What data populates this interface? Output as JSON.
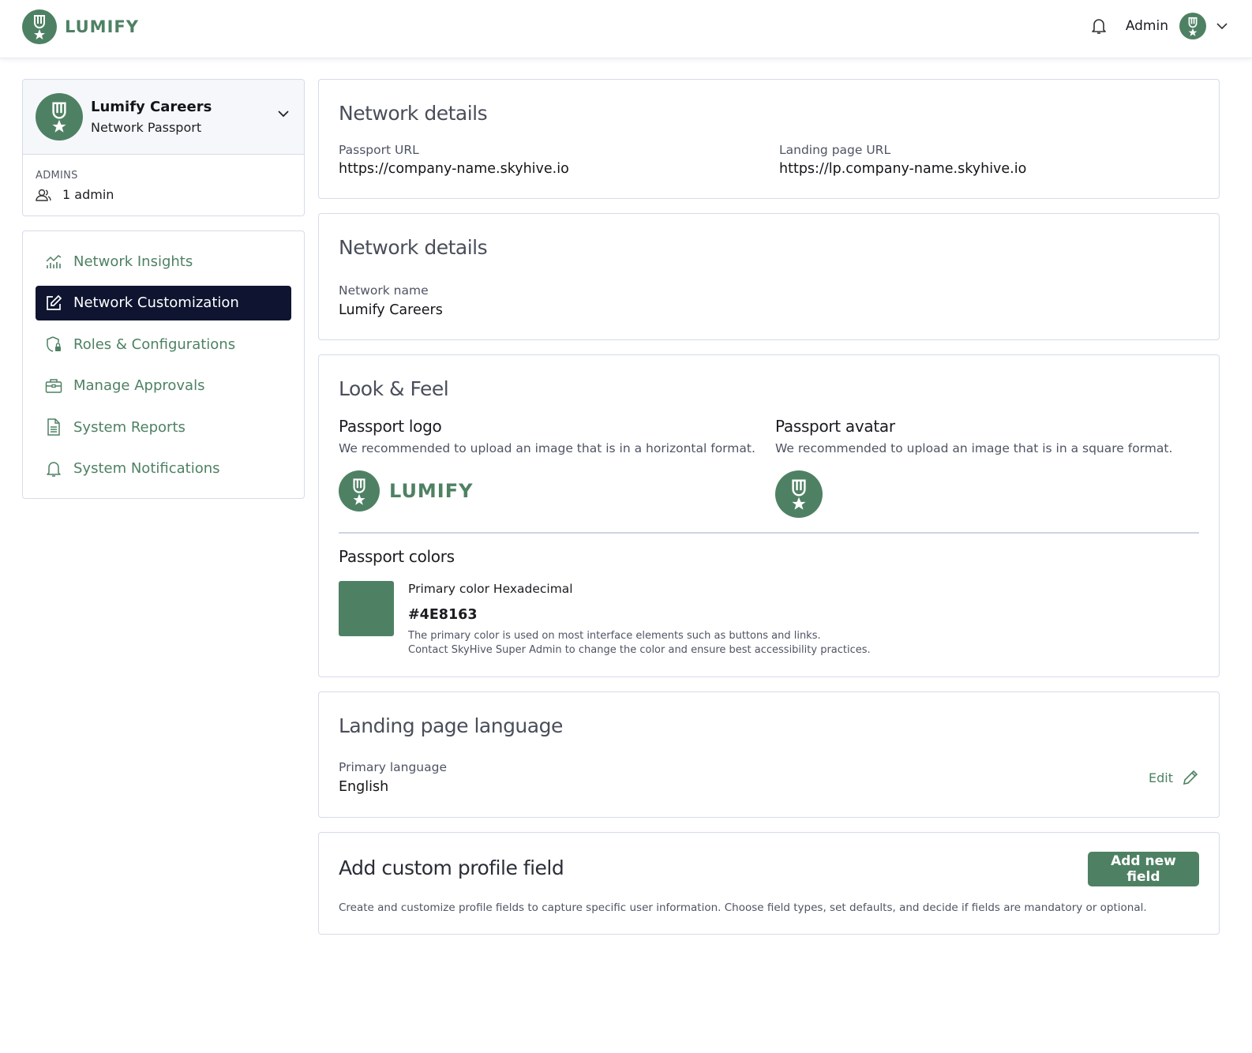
{
  "app": {
    "brand": "LUMIFY",
    "accent_color": "#4E8163",
    "nav_dark": "#0f1530"
  },
  "header": {
    "notification_icon": "bell-icon",
    "user_name": "Admin",
    "user_avatar_icon": "medal-icon",
    "menu_icon": "chevron-down-icon"
  },
  "sidebar": {
    "org": {
      "title": "Lumify Careers",
      "subtitle": "Network Passport",
      "admins_label": "ADMINS",
      "admins_count": "1 admin"
    },
    "items": [
      {
        "label": "Network Insights",
        "icon": "chart-icon",
        "active": false
      },
      {
        "label": "Network Customization",
        "icon": "edit-icon",
        "active": true
      },
      {
        "label": "Roles & Configurations",
        "icon": "shield-lock-icon",
        "active": false
      },
      {
        "label": "Manage Approvals",
        "icon": "briefcase-icon",
        "active": false
      },
      {
        "label": "System Reports",
        "icon": "document-icon",
        "active": false
      },
      {
        "label": "System Notifications",
        "icon": "bell-icon",
        "active": false
      }
    ]
  },
  "main": {
    "urls_card": {
      "title": "Network details",
      "passport_url_label": "Passport URL",
      "passport_url": "https://company-name.skyhive.io",
      "landing_url_label": "Landing page URL",
      "landing_url": "https://lp.company-name.skyhive.io"
    },
    "name_card": {
      "title": "Network details",
      "network_name_label": "Network name",
      "network_name": "Lumify Careers"
    },
    "look_feel": {
      "title": "Look & Feel",
      "logo_title": "Passport logo",
      "logo_hint": "We recommended to upload an image that is in a horizontal format.",
      "logo_text": "LUMIFY",
      "avatar_title": "Passport avatar",
      "avatar_hint": "We recommended to upload an image that is in a square format.",
      "colors_title": "Passport colors",
      "primary_label": "Primary color Hexadecimal",
      "primary_hex": "#4E8163",
      "primary_note_1": "The primary color is used on most interface elements such as buttons and links.",
      "primary_note_2": "Contact SkyHive Super Admin to change the color and ensure best accessibility practices."
    },
    "language": {
      "title": "Landing page language",
      "primary_label": "Primary language",
      "primary_value": "English",
      "edit_label": "Edit"
    },
    "custom_field": {
      "title": "Add custom profile field",
      "button_label": "Add new field",
      "description": "Create and customize profile fields to capture specific user information. Choose field types, set defaults, and decide if fields are mandatory or optional."
    }
  }
}
